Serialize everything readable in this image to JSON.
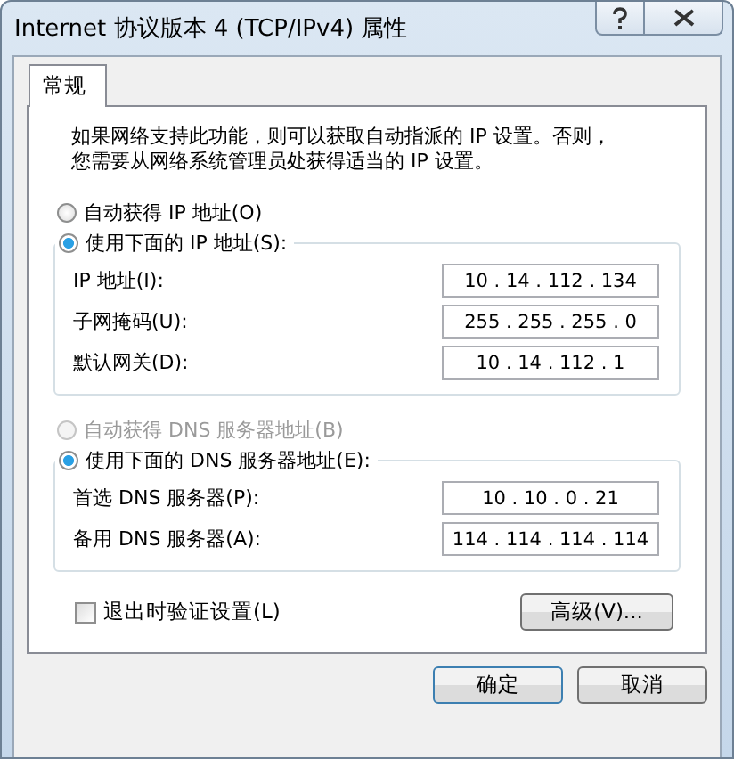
{
  "window": {
    "title": "Internet 协议版本 4 (TCP/IPv4) 属性"
  },
  "tabs": [
    {
      "label": "常规",
      "selected": true
    }
  ],
  "description": [
    "如果网络支持此功能，则可以获取自动指派的 IP 设置。否则，",
    "您需要从网络系统管理员处获得适当的 IP 设置。"
  ],
  "sections": [
    {
      "options": [
        {
          "label": "自动获得 IP 地址(O)",
          "selected": false,
          "disabled": false
        },
        {
          "label": "使用下面的 IP 地址(S):",
          "selected": true,
          "disabled": false
        }
      ],
      "fields": [
        {
          "label": "IP 地址(I):",
          "value": "10 . 14 . 112 . 134",
          "disabled": false
        },
        {
          "label": "子网掩码(U):",
          "value": "255 . 255 . 255 . 0",
          "disabled": false
        },
        {
          "label": "默认网关(D):",
          "value": "10 . 14 . 112 . 1",
          "disabled": false
        }
      ]
    },
    {
      "options": [
        {
          "label": "自动获得 DNS 服务器地址(B)",
          "selected": false,
          "disabled": true
        },
        {
          "label": "使用下面的 DNS 服务器地址(E):",
          "selected": true,
          "disabled": false
        }
      ],
      "fields": [
        {
          "label": "首选 DNS 服务器(P):",
          "value": "10 . 10 . 0 . 21",
          "disabled": false
        },
        {
          "label": "备用 DNS 服务器(A):",
          "value": "114 . 114 . 114 . 114",
          "disabled": false
        }
      ]
    }
  ],
  "validate_on_exit": {
    "label": "退出时验证设置(L)",
    "checked": false
  },
  "advanced_button": "高级(V)...",
  "buttons": [
    "确定",
    "取消"
  ]
}
